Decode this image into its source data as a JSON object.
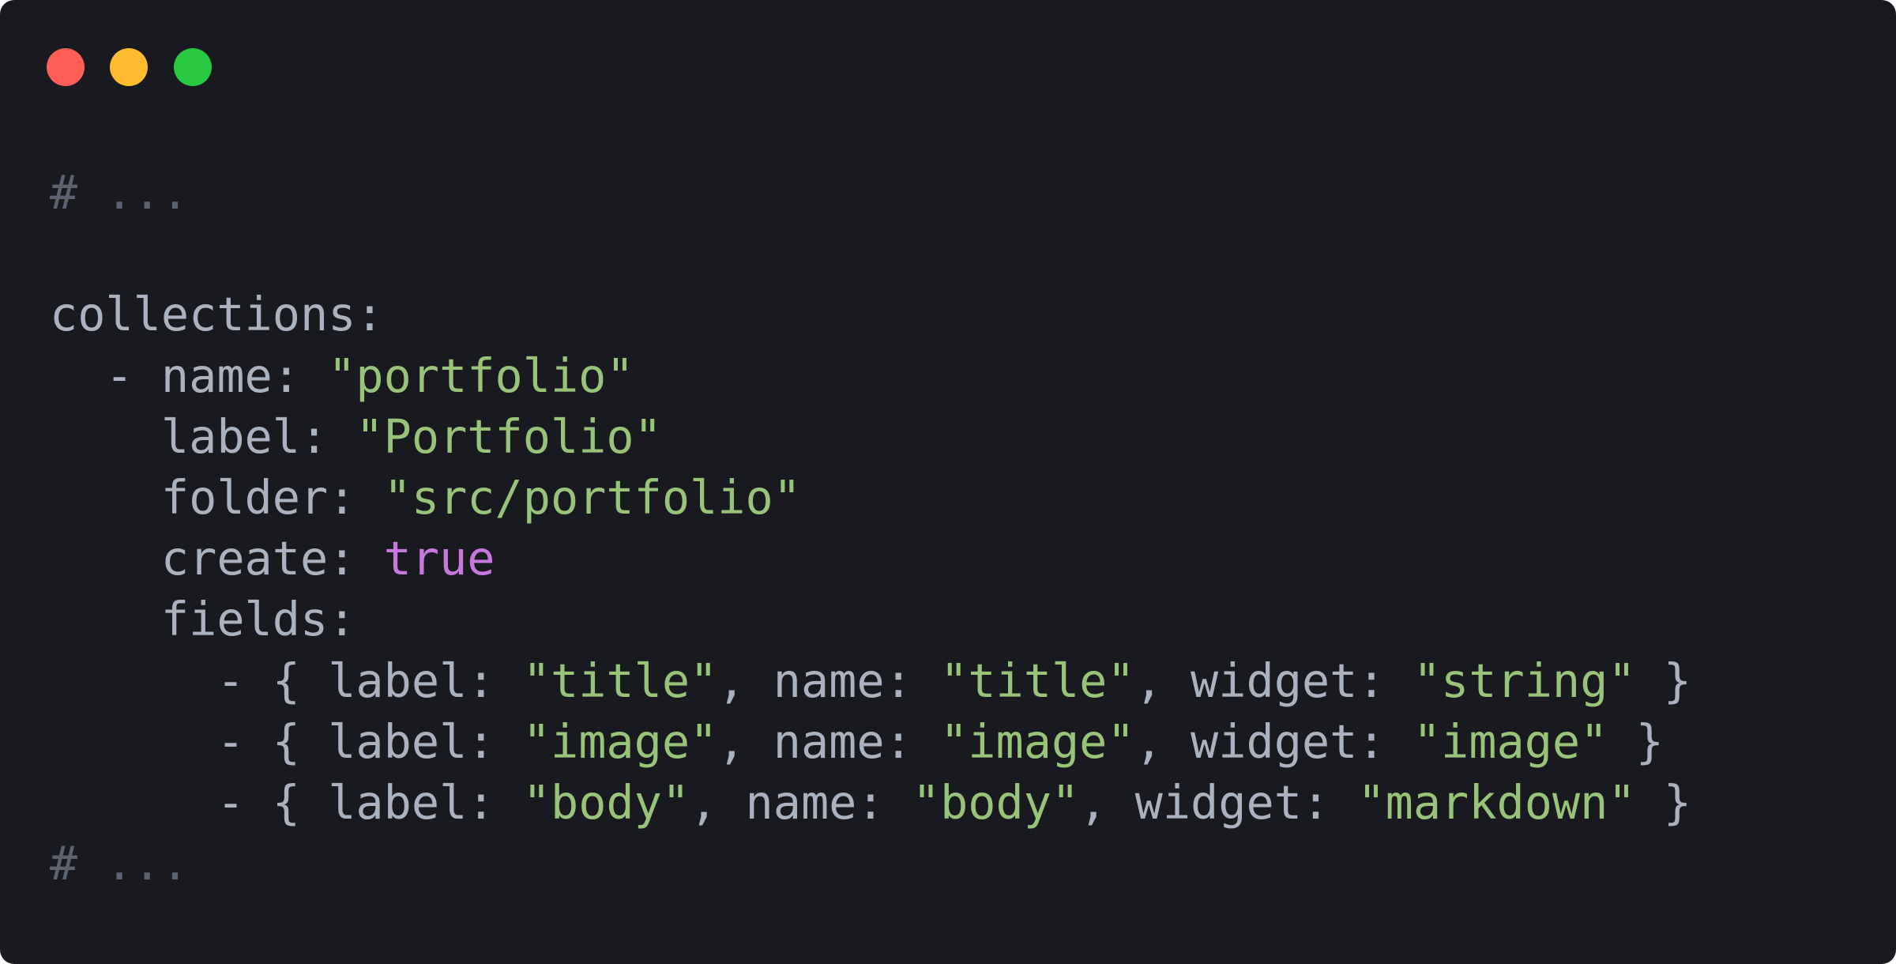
{
  "window": {
    "controls": [
      {
        "name": "close-button",
        "icon": "close-dot-icon",
        "color": "#ff5f57"
      },
      {
        "name": "minimize-button",
        "icon": "minimize-dot-icon",
        "color": "#febc2e"
      },
      {
        "name": "zoom-button",
        "icon": "zoom-dot-icon",
        "color": "#28c840"
      }
    ],
    "background": "#181a1f"
  },
  "theme": {
    "comment": "#5c6370",
    "plain": "#abb2bf",
    "string": "#98c379",
    "boolean": "#c678dd"
  },
  "code": {
    "language": "yaml",
    "lines": [
      [
        {
          "t": "comment",
          "v": "# ..."
        }
      ],
      [],
      [
        {
          "t": "plain",
          "v": "collections:"
        }
      ],
      [
        {
          "t": "plain",
          "v": "  - name: "
        },
        {
          "t": "string",
          "v": "\"portfolio\""
        }
      ],
      [
        {
          "t": "plain",
          "v": "    label: "
        },
        {
          "t": "string",
          "v": "\"Portfolio\""
        }
      ],
      [
        {
          "t": "plain",
          "v": "    folder: "
        },
        {
          "t": "string",
          "v": "\"src/portfolio\""
        }
      ],
      [
        {
          "t": "plain",
          "v": "    create: "
        },
        {
          "t": "bool",
          "v": "true"
        }
      ],
      [
        {
          "t": "plain",
          "v": "    fields:"
        }
      ],
      [
        {
          "t": "plain",
          "v": "      - { label: "
        },
        {
          "t": "string",
          "v": "\"title\""
        },
        {
          "t": "plain",
          "v": ", name: "
        },
        {
          "t": "string",
          "v": "\"title\""
        },
        {
          "t": "plain",
          "v": ", widget: "
        },
        {
          "t": "string",
          "v": "\"string\""
        },
        {
          "t": "plain",
          "v": " }"
        }
      ],
      [
        {
          "t": "plain",
          "v": "      - { label: "
        },
        {
          "t": "string",
          "v": "\"image\""
        },
        {
          "t": "plain",
          "v": ", name: "
        },
        {
          "t": "string",
          "v": "\"image\""
        },
        {
          "t": "plain",
          "v": ", widget: "
        },
        {
          "t": "string",
          "v": "\"image\""
        },
        {
          "t": "plain",
          "v": " }"
        }
      ],
      [
        {
          "t": "plain",
          "v": "      - { label: "
        },
        {
          "t": "string",
          "v": "\"body\""
        },
        {
          "t": "plain",
          "v": ", name: "
        },
        {
          "t": "string",
          "v": "\"body\""
        },
        {
          "t": "plain",
          "v": ", widget: "
        },
        {
          "t": "string",
          "v": "\"markdown\""
        },
        {
          "t": "plain",
          "v": " }"
        }
      ],
      [
        {
          "t": "comment",
          "v": "# ..."
        }
      ]
    ]
  }
}
